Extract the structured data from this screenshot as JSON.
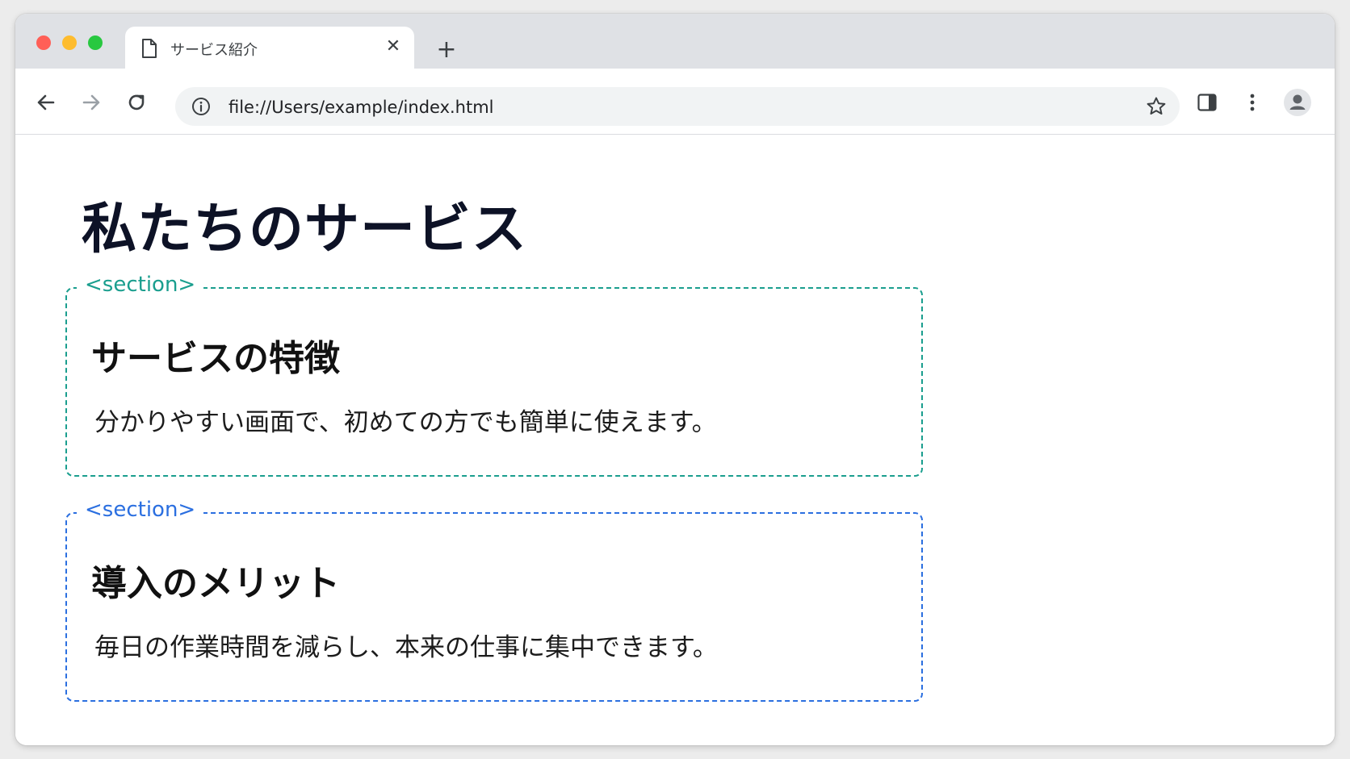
{
  "browser": {
    "tab_title": "サービス紹介",
    "tab_close": "✕",
    "new_tab": "+",
    "url": "file://Users/example/index.html"
  },
  "icons": {
    "tab": "page-icon",
    "close": "close-icon",
    "new_tab": "plus-icon",
    "back": "back-arrow-icon",
    "forward": "forward-arrow-icon",
    "reload": "reload-icon",
    "info": "info-icon",
    "bookmark": "star-icon",
    "side_panel": "side-panel-icon",
    "menu": "kebab-menu-icon",
    "profile": "profile-icon"
  },
  "page": {
    "title": "私たちのサービス",
    "sections": [
      {
        "tag": "<section>",
        "heading": "サービスの特徴",
        "text": "分かりやすい画面で、初めての方でも簡単に使えます。",
        "color": "#1a9e8e"
      },
      {
        "tag": "<section>",
        "heading": "導入のメリット",
        "text": "毎日の作業時間を減らし、本来の仕事に集中できます。",
        "color": "#2b6fe0"
      }
    ]
  }
}
